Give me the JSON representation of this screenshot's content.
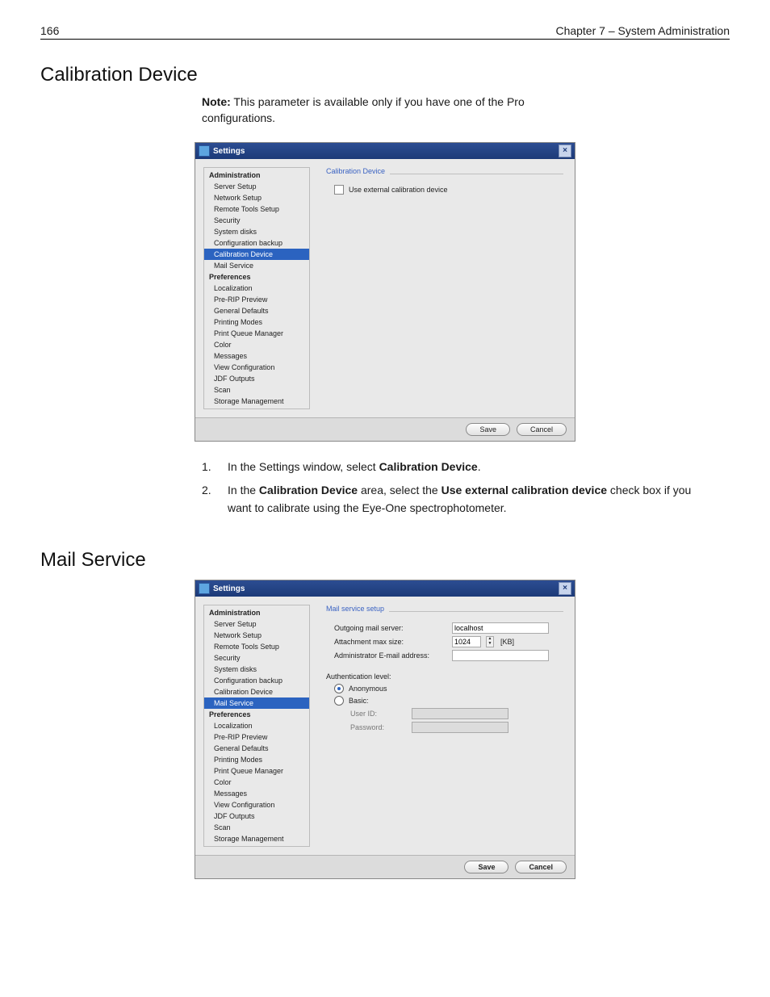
{
  "header": {
    "page_num": "166",
    "chapter": "Chapter 7 – System Administration"
  },
  "section1": {
    "title": "Calibration Device",
    "note_label": "Note:",
    "note_text": "This parameter is available only if you have one of the Pro configurations."
  },
  "shot": {
    "window_title": "Settings",
    "nav": {
      "group_admin": "Administration",
      "admin_items": [
        "Server Setup",
        "Network Setup",
        "Remote Tools Setup",
        "Security",
        "System disks",
        "Configuration backup",
        "Calibration Device",
        "Mail Service"
      ],
      "group_prefs": "Preferences",
      "prefs_items": [
        "Localization",
        "Pre-RIP Preview",
        "General Defaults",
        "Printing Modes",
        "Print Queue Manager",
        "Color",
        "Messages",
        "View Configuration",
        "JDF Outputs",
        "Scan",
        "Storage Management"
      ]
    },
    "calib": {
      "group_label": "Calibration Device",
      "checkbox_label": "Use external calibration device"
    },
    "mail": {
      "group_label": "Mail service setup",
      "out_server_label": "Outgoing mail server:",
      "out_server_value": "localhost",
      "attach_label": "Attachment max size:",
      "attach_value": "1024",
      "attach_unit": "[KB]",
      "admin_email_label": "Administrator E-mail address:",
      "admin_email_value": "",
      "auth_label": "Authentication level:",
      "auth_anon": "Anonymous",
      "auth_basic": "Basic:",
      "userid_label": "User ID:",
      "password_label": "Password:"
    },
    "buttons": {
      "save": "Save",
      "cancel": "Cancel"
    }
  },
  "instr1": {
    "n1": "1.",
    "t1a": "In the Settings window, select ",
    "t1b": "Calibration Device",
    "t1c": ".",
    "n2": "2.",
    "t2a": "In the ",
    "t2b": "Calibration Device",
    "t2c": " area, select the ",
    "t2d": "Use external calibration device",
    "t2e": " check box if you want to calibrate using the Eye-One spectrophotometer."
  },
  "section2": {
    "title": "Mail Service"
  }
}
